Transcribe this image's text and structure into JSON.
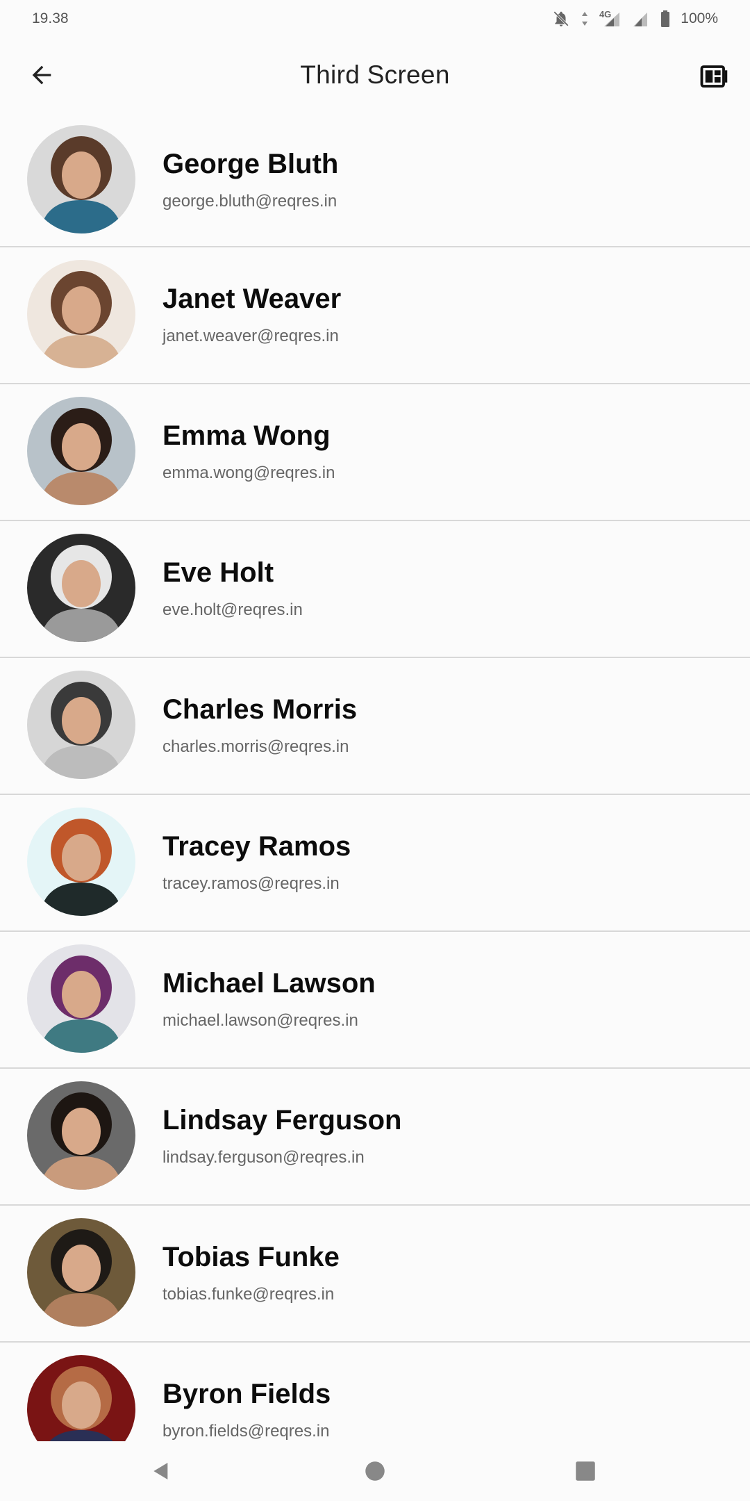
{
  "status_bar": {
    "time": "19.38",
    "network": "4G",
    "battery": "100%"
  },
  "app_bar": {
    "title": "Third Screen",
    "back_icon": "arrow-left-icon",
    "action_icon": "dashboard-icon"
  },
  "users": [
    {
      "name": "George Bluth",
      "email": "george.bluth@reqres.in",
      "avatar_colors": [
        "#d9d9d9",
        "#5a3b2a",
        "#2c6c8a"
      ]
    },
    {
      "name": "Janet Weaver",
      "email": "janet.weaver@reqres.in",
      "avatar_colors": [
        "#efe7df",
        "#6b4530",
        "#d7b294"
      ]
    },
    {
      "name": "Emma Wong",
      "email": "emma.wong@reqres.in",
      "avatar_colors": [
        "#b8c2c9",
        "#2b1d17",
        "#b98a6c"
      ]
    },
    {
      "name": "Eve Holt",
      "email": "eve.holt@reqres.in",
      "avatar_colors": [
        "#2a2a2a",
        "#e6e6e6",
        "#9a9a9a"
      ]
    },
    {
      "name": "Charles Morris",
      "email": "charles.morris@reqres.in",
      "avatar_colors": [
        "#d6d6d6",
        "#3a3a3a",
        "#bcbcbc"
      ]
    },
    {
      "name": "Tracey Ramos",
      "email": "tracey.ramos@reqres.in",
      "avatar_colors": [
        "#e4f5f7",
        "#c0572a",
        "#1f2a2a"
      ]
    },
    {
      "name": "Michael Lawson",
      "email": "michael.lawson@reqres.in",
      "avatar_colors": [
        "#e3e3e8",
        "#6d2d6a",
        "#3f7a82"
      ]
    },
    {
      "name": "Lindsay Ferguson",
      "email": "lindsay.ferguson@reqres.in",
      "avatar_colors": [
        "#6a6a6a",
        "#1d1612",
        "#c99b7c"
      ]
    },
    {
      "name": "Tobias Funke",
      "email": "tobias.funke@reqres.in",
      "avatar_colors": [
        "#6e5a3a",
        "#1e1a16",
        "#b07f5e"
      ]
    },
    {
      "name": "Byron Fields",
      "email": "byron.fields@reqres.in",
      "avatar_colors": [
        "#7a1414",
        "#b56b45",
        "#2a2f55"
      ]
    }
  ],
  "nav_bar": {
    "back_icon": "triangle-back-icon",
    "home_icon": "circle-home-icon",
    "recents_icon": "square-recents-icon"
  }
}
